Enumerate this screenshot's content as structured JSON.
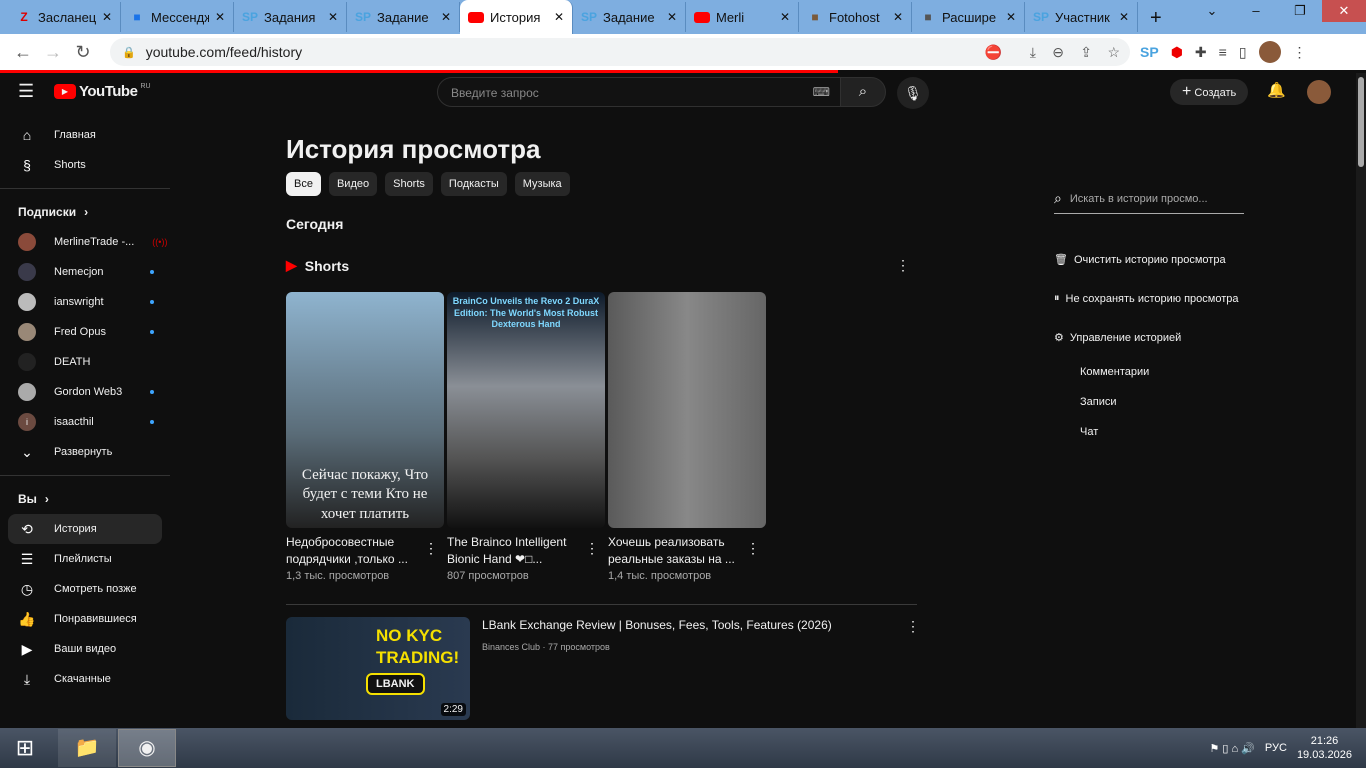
{
  "browser": {
    "tabs": [
      {
        "title": "Засланец",
        "icon": "Z",
        "color": "#d00",
        "active": false
      },
      {
        "title": "Мессенджер",
        "icon": "msg",
        "color": "#1a73e8",
        "active": false
      },
      {
        "title": "Задания",
        "icon": "SP",
        "color": "#4aa3df",
        "active": false
      },
      {
        "title": "Задание",
        "icon": "SP",
        "color": "#4aa3df",
        "active": false
      },
      {
        "title": "История",
        "icon": "yt",
        "color": "#f00",
        "active": true
      },
      {
        "title": "Задание",
        "icon": "SP",
        "color": "#4aa3df",
        "active": false
      },
      {
        "title": "Merli",
        "icon": "yt",
        "color": "#f00",
        "active": false
      },
      {
        "title": "Fotohost",
        "icon": "img",
        "color": "#7a5a3a",
        "active": false
      },
      {
        "title": "Расшире",
        "icon": "puzzle",
        "color": "#555",
        "active": false
      },
      {
        "title": "Участник",
        "icon": "SP",
        "color": "#4aa3df",
        "active": false
      }
    ],
    "new_tab": "+",
    "url": "youtube.com/feed/history"
  },
  "yt": {
    "logo": "YouTube",
    "region": "RU",
    "search_placeholder": "Введите запрос",
    "create": "Создать"
  },
  "sidebar": {
    "main": [
      {
        "label": "Главная",
        "icon": "home-icon"
      },
      {
        "label": "Shorts",
        "icon": "shorts-icon"
      }
    ],
    "subs_header": "Подписки",
    "subs": [
      {
        "label": "MerlineTrade -...",
        "color": "#8a4a3a",
        "live": true
      },
      {
        "label": "Nemecjon",
        "color": "#3a3a4a",
        "new": true
      },
      {
        "label": "ianswright",
        "color": "#bbb",
        "new": true
      },
      {
        "label": "Fred Opus",
        "color": "#998877",
        "new": true
      },
      {
        "label": "DEATH",
        "color": "#222",
        "new": false
      },
      {
        "label": "Gordon Web3",
        "color": "#aaa",
        "new": true
      },
      {
        "label": "isaacthil",
        "color": "#6b4a40",
        "new": true,
        "letter": "i"
      }
    ],
    "expand": "Развернуть",
    "you_header": "Вы",
    "you": [
      {
        "label": "История",
        "icon": "history-icon",
        "glyph": "⟲",
        "active": true
      },
      {
        "label": "Плейлисты",
        "icon": "playlists-icon",
        "glyph": "☰"
      },
      {
        "label": "Смотреть позже",
        "icon": "clock-icon",
        "glyph": "◷"
      },
      {
        "label": "Понравившиеся",
        "icon": "like-icon",
        "glyph": "👍"
      },
      {
        "label": "Ваши видео",
        "icon": "video-icon",
        "glyph": "▶"
      },
      {
        "label": "Скачанные",
        "icon": "download-icon",
        "glyph": "⤓"
      }
    ]
  },
  "main": {
    "title": "История просмотра",
    "chips": [
      "Все",
      "Видео",
      "Shorts",
      "Подкасты",
      "Музыка"
    ],
    "section": "Сегодня",
    "shorts_label": "Shorts",
    "shorts": [
      {
        "title": "Недобросовестные подрядчики ,только ...",
        "views": "1,3 тыс. просмотров",
        "overlay": "Сейчас покажу, Что будет с теми Кто не хочет платить",
        "bg": "linear-gradient(#8fb4cf,#5a6c78 60%,#222)"
      },
      {
        "title": "The Brainco Intelligent Bionic Hand ❤□...",
        "views": "807 просмотров",
        "overlay": "BrainCo Unveils the Revo 2 DuraX Edition: The World's Most Robust Dexterous Hand",
        "bg": "linear-gradient(#0d1a2a,#8a8f96 40%,#555 70%,#111)"
      },
      {
        "title": "Хочешь реализовать реальные заказы на ...",
        "views": "1,4 тыс. просмотров",
        "overlay": "",
        "bg": "linear-gradient(90deg,#5a5a5a,#888 50%,#666)"
      }
    ],
    "video": {
      "title": "LBank Exchange Review | Bonuses, Fees, Tools, Features (2026)",
      "meta": "Binances Club · 77 просмотров",
      "duration": "2:29",
      "thumb_text": "NO KYC TRADING!",
      "thumb_badge": "LBANK"
    }
  },
  "right": {
    "search_placeholder": "Искать в истории просмо...",
    "clear": "Очистить историю просмотра",
    "pause": "Не сохранять историю просмотра",
    "manage": "Управление историей",
    "sub": [
      "Комментарии",
      "Записи",
      "Чат"
    ]
  },
  "taskbar": {
    "lang": "РУС",
    "time": "21:26",
    "date": "19.03.2026"
  }
}
